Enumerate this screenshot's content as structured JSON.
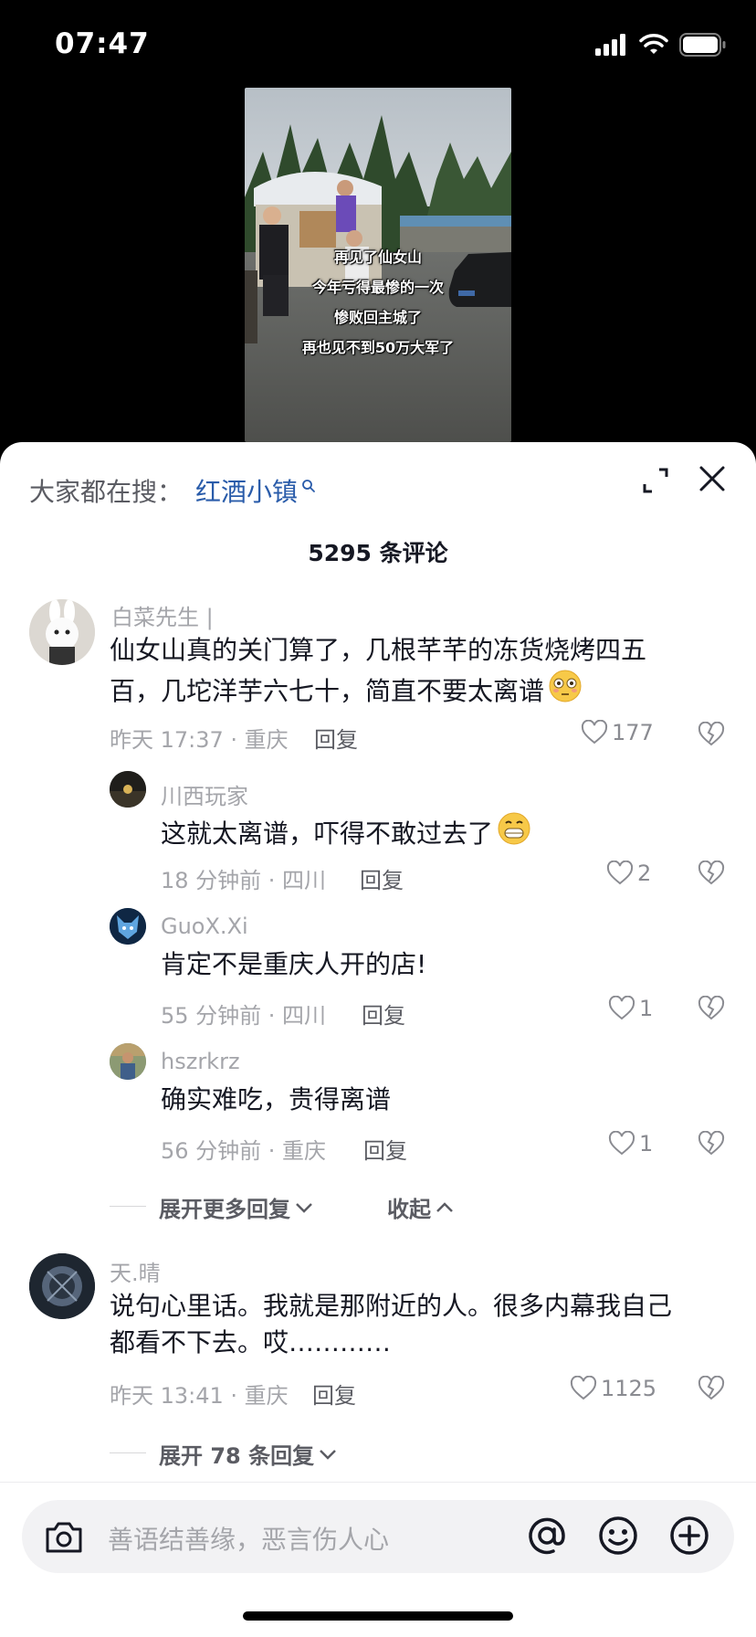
{
  "status": {
    "time": "07:47"
  },
  "video": {
    "captions": [
      "再见了仙女山",
      "今年亏得最惨的一次",
      "惨败回主城了",
      "再也见不到50万大军了"
    ]
  },
  "sheet": {
    "search_prefix": "大家都在搜：",
    "search_term": "红酒小镇",
    "comment_count": "5295 条评论",
    "reply_label": "回复"
  },
  "comments": [
    {
      "user": "白菜先生 |",
      "text_line1": "仙女山真的关门算了，几根芊芊的冻货烧烤四五",
      "text_line2": "百，几坨洋芋六七十，简直不要太离谱",
      "meta": "昨天 17:37 · 重庆",
      "likes": "177",
      "replies": [
        {
          "user": "川西玩家",
          "text": "这就太离谱，吓得不敢过去了",
          "meta": "18 分钟前 · 四川",
          "likes": "2"
        },
        {
          "user": "GuoX.Xi",
          "text": "肯定不是重庆人开的店!",
          "meta": "55 分钟前 · 四川",
          "likes": "1"
        },
        {
          "user": "hszrkrz",
          "text": "确实难吃，贵得离谱",
          "meta": "56 分钟前 · 重庆",
          "likes": "1"
        }
      ],
      "expand_more": "展开更多回复",
      "collapse": "收起"
    },
    {
      "user": "天.晴",
      "text_line1": "说句心里话。我就是那附近的人。很多内幕我自己",
      "text_line2": "都看不下去。哎…………",
      "meta": "昨天 13:41 · 重庆",
      "likes": "1125",
      "expand": "展开 78 条回复"
    }
  ],
  "input": {
    "placeholder": "善语结善缘，恶言伤人心"
  },
  "icons": [
    "signal-icon",
    "wifi-icon",
    "battery-icon",
    "search-small-icon",
    "expand-icon",
    "close-icon",
    "heart-icon",
    "broken-heart-icon",
    "chevron-down-icon",
    "chevron-up-icon",
    "camera-icon",
    "at-icon",
    "emoji-icon",
    "plus-icon"
  ],
  "colors": {
    "link": "#2a5caa",
    "secondary_text": "#a4a5aa",
    "text": "#161823"
  }
}
